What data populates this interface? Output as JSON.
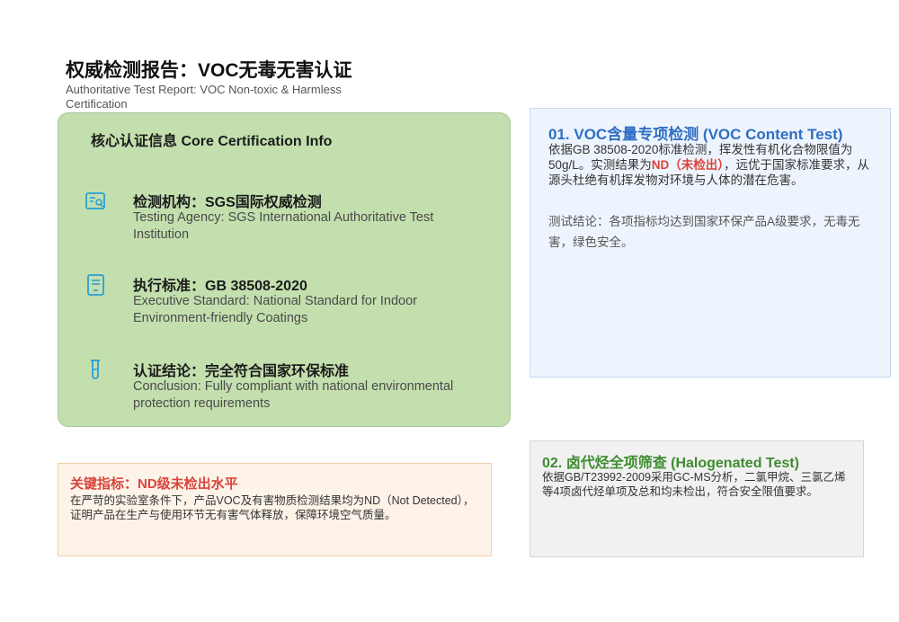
{
  "header": {
    "title": "权威检测报告：VOC无毒无害认证",
    "subtitle": "Authoritative Test Report: VOC Non-toxic & Harmless Certification"
  },
  "core": {
    "title": "核心认证信息 Core Certification Info",
    "items": [
      {
        "icon": "agency-report-icon",
        "zh": "检测机构：SGS国际权威检测",
        "en": "Testing Agency: SGS International Authoritative Test Institution"
      },
      {
        "icon": "standard-document-icon",
        "zh": "执行标准：GB 38508-2020",
        "en": "Executive Standard: National Standard for Indoor Environment-friendly Coatings"
      },
      {
        "icon": "test-tube-icon",
        "zh": "认证结论：完全符合国家环保标准",
        "en": "Conclusion: Fully compliant with national environmental protection requirements"
      }
    ]
  },
  "key_indicator": {
    "title": "关键指标：ND级未检出水平",
    "body": "在严苛的实验室条件下，产品VOC及有害物质检测结果均为ND（Not Detected），证明产品在生产与使用环节无有害气体释放，保障环境空气质量。"
  },
  "voc_test": {
    "title": "01. VOC含量专项检测 (VOC Content Test)",
    "body_pre": "依据GB 38508-2020标准检测，挥发性有机化合物限值为50g/L。实测结果为",
    "body_highlight": "ND（未检出）",
    "body_post": "，远优于国家标准要求，从源头杜绝有机挥发物对环境与人体的潜在危害。",
    "conclusion": "测试结论：各项指标均达到国家环保产品A级要求，无毒无害，绿色安全。"
  },
  "halogen_test": {
    "title": "02. 卤代烃全项筛查 (Halogenated Test)",
    "body": "依据GB/T23992-2009采用GC-MS分析，二氯甲烷、三氯乙烯等4项卤代烃单项及总和均未检出，符合安全限值要求。"
  },
  "colors": {
    "core_bg": "#c3dfae",
    "accent_blue": "#2f6fc4",
    "accent_red": "#d9443a",
    "accent_green": "#3e8c2f",
    "icon_blue": "#2a9fd6"
  }
}
